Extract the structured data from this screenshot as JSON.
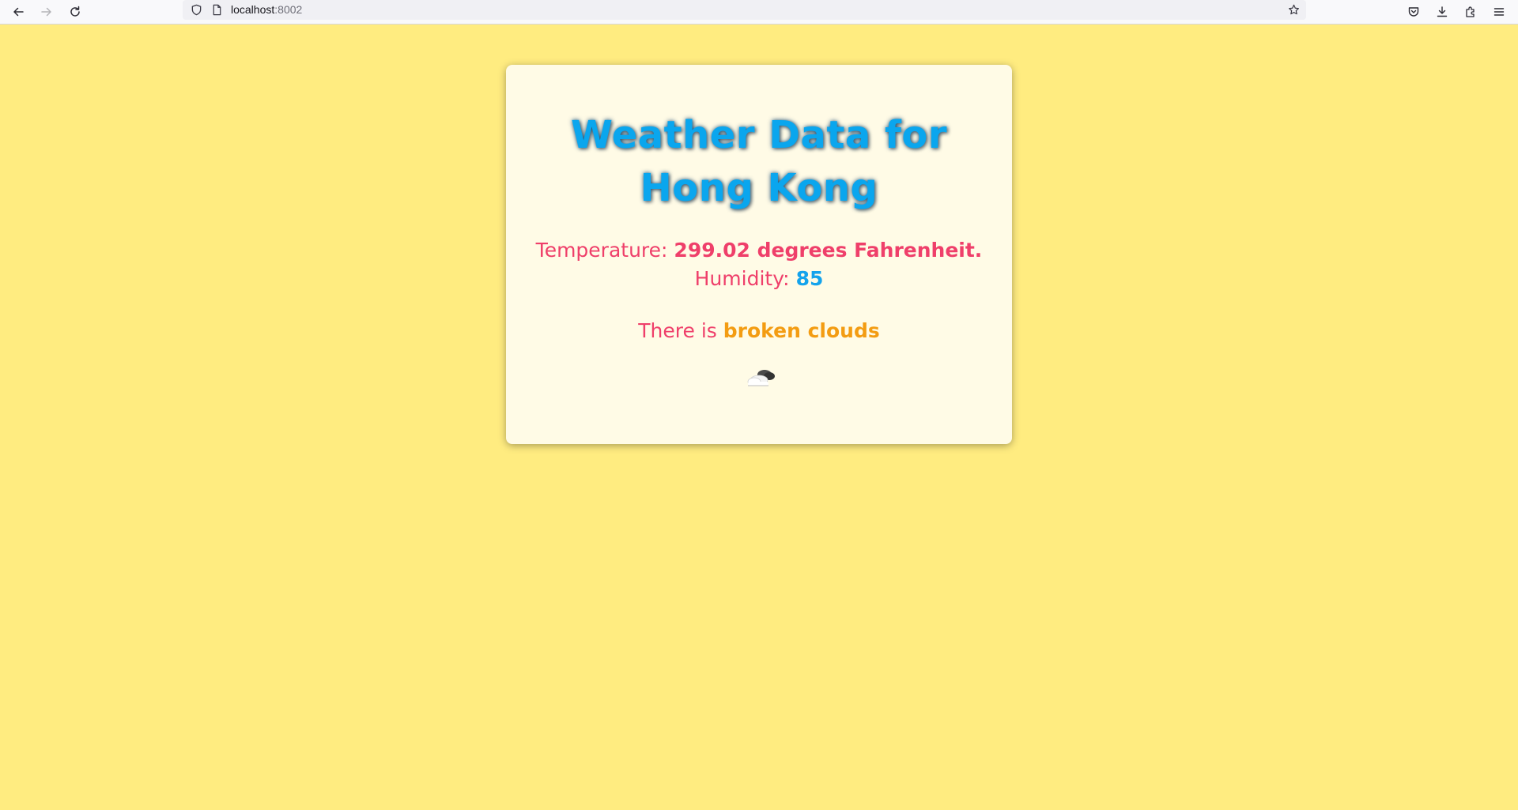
{
  "browser": {
    "url_host": "localhost",
    "url_port": ":8002"
  },
  "weather": {
    "title": "Weather Data for Hong Kong",
    "temperature_label": "Temperature:",
    "temperature_value": "299.02 degrees Fahrenheit.",
    "humidity_label": "Humidity:",
    "humidity_value": "85",
    "description_prefix": "There is",
    "description_value": "broken clouds",
    "icon": "broken-clouds-icon"
  },
  "colors": {
    "page_background": "#ffec80",
    "card_background": "#fffbe6",
    "title": "#0aa6ee",
    "label": "#ef3f6a",
    "humidity_value": "#14a3ec",
    "description_value": "#f39c12"
  }
}
